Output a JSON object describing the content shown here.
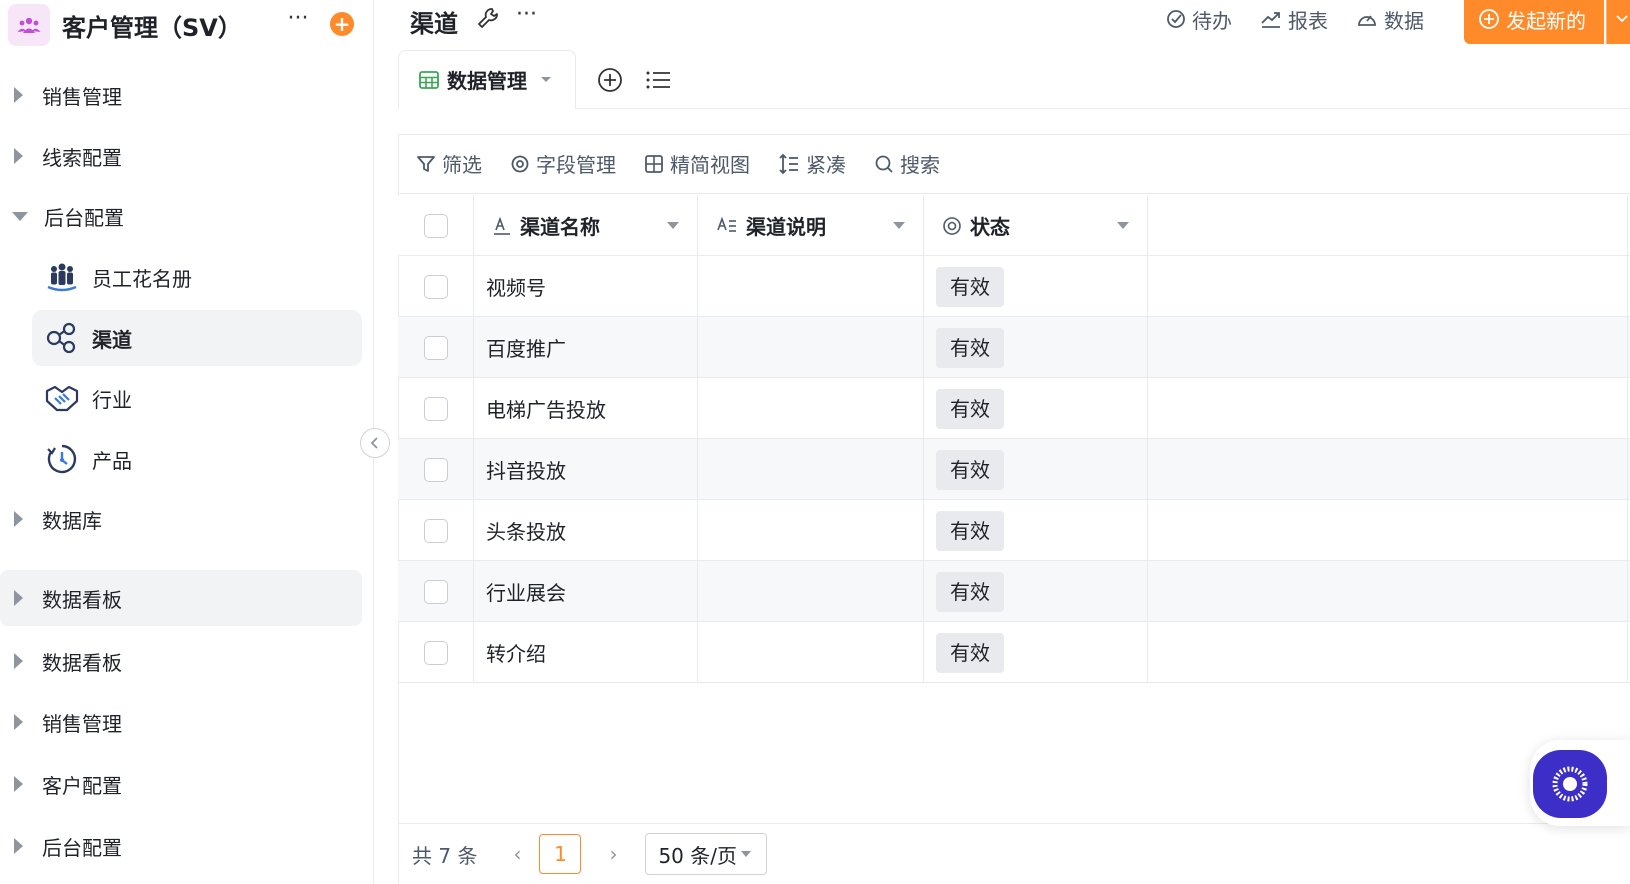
{
  "app": {
    "title": "客户管理（SV）"
  },
  "sidebar": {
    "items": [
      {
        "label": "销售管理"
      },
      {
        "label": "线索配置"
      },
      {
        "label": "后台配置"
      },
      {
        "label": "数据库"
      },
      {
        "label": "数据看板"
      },
      {
        "label": "数据看板"
      },
      {
        "label": "销售管理"
      },
      {
        "label": "客户配置"
      },
      {
        "label": "后台配置"
      }
    ],
    "sub_items": [
      {
        "label": "员工花名册",
        "icon": "people-group-icon"
      },
      {
        "label": "渠道",
        "icon": "share-nodes-icon"
      },
      {
        "label": "行业",
        "icon": "handshake-icon"
      },
      {
        "label": "产品",
        "icon": "product-cycle-icon"
      }
    ]
  },
  "header": {
    "title": "渠道",
    "actions": {
      "todo": "待办",
      "report": "报表",
      "data": "数据"
    },
    "primary_label": "发起新的"
  },
  "tabs": {
    "active_label": "数据管理"
  },
  "toolbar": {
    "filter": "筛选",
    "fields": "字段管理",
    "compact_view": "精简视图",
    "density": "紧凑",
    "search": "搜索"
  },
  "table": {
    "columns": [
      "渠道名称",
      "渠道说明",
      "状态"
    ],
    "rows": [
      {
        "name": "视频号",
        "desc": "",
        "status": "有效"
      },
      {
        "name": "百度推广",
        "desc": "",
        "status": "有效"
      },
      {
        "name": "电梯广告投放",
        "desc": "",
        "status": "有效"
      },
      {
        "name": "抖音投放",
        "desc": "",
        "status": "有效"
      },
      {
        "name": "头条投放",
        "desc": "",
        "status": "有效"
      },
      {
        "name": "行业展会",
        "desc": "",
        "status": "有效"
      },
      {
        "name": "转介绍",
        "desc": "",
        "status": "有效"
      }
    ]
  },
  "pagination": {
    "total": "共 7 条",
    "current": "1",
    "page_size": "50 条/页"
  },
  "colors": {
    "accent": "#ff8a2a",
    "assistant": "#3d2ec7"
  }
}
